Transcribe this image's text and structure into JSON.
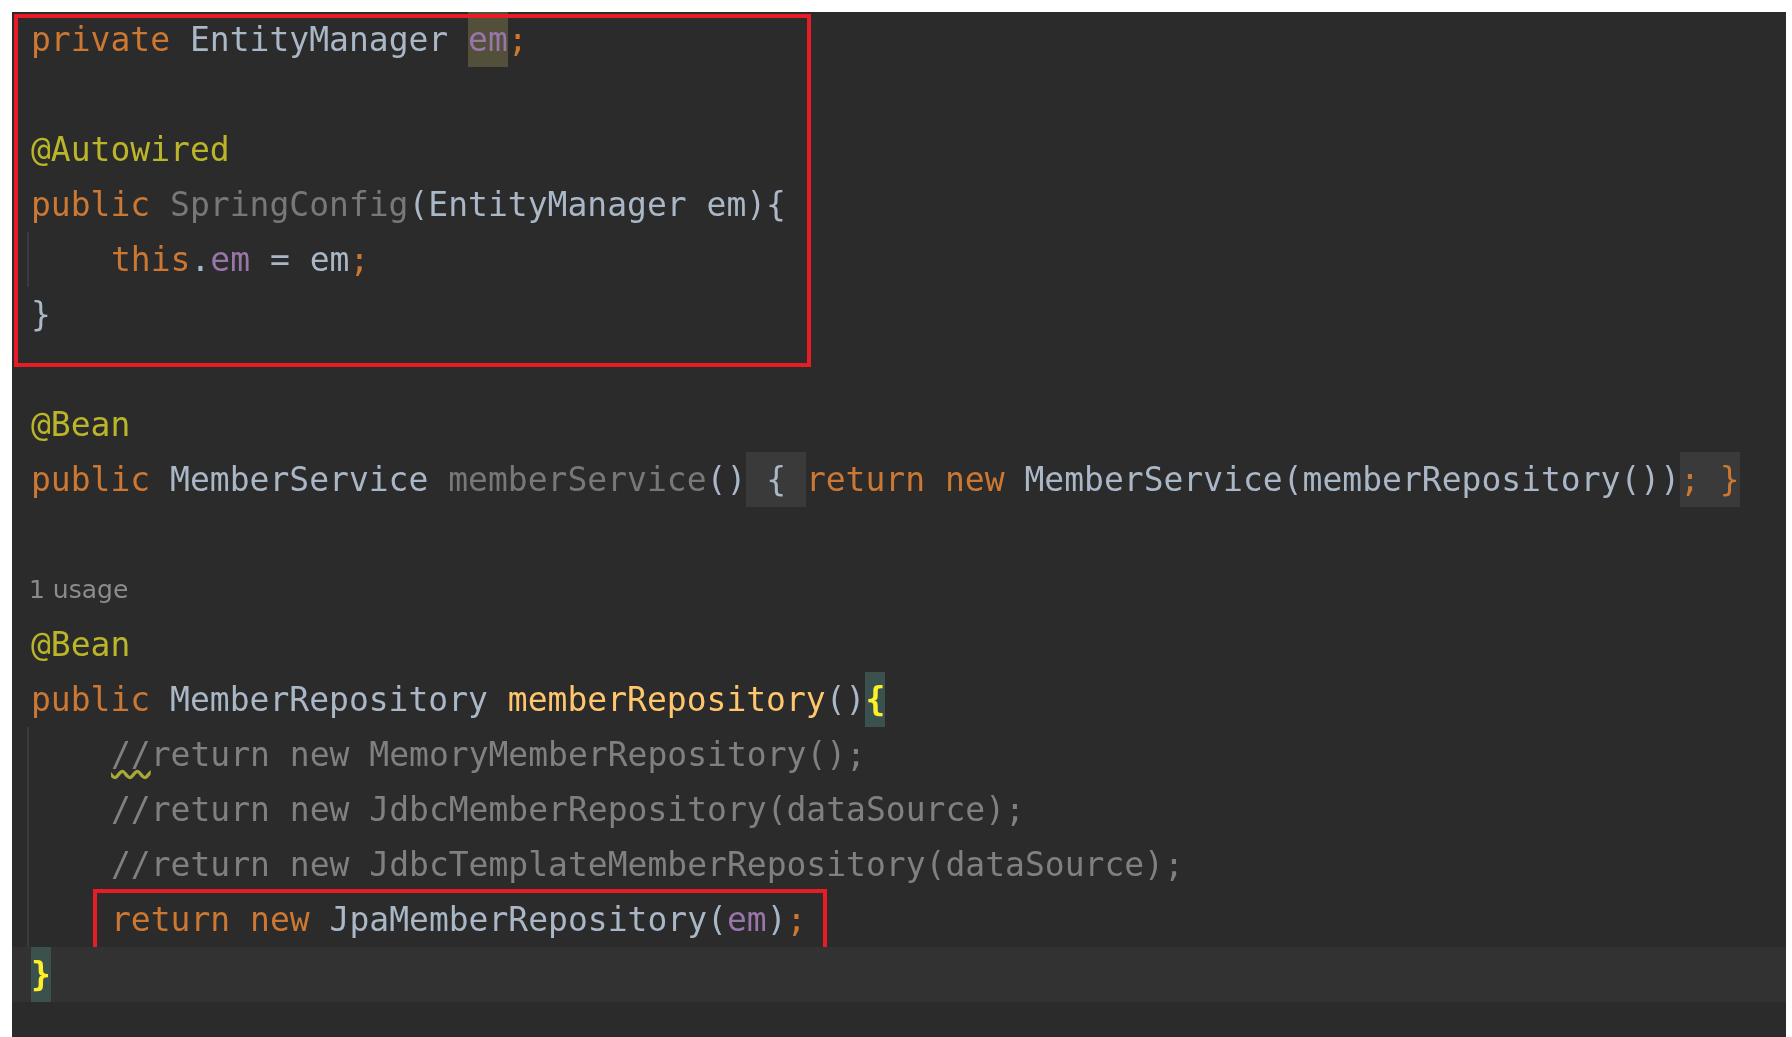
{
  "blocks": [
    {
      "boxed": true,
      "lines": [
        {
          "kind": "code",
          "indented": false,
          "tokens": [
            {
              "text": "private ",
              "kind": "keyword"
            },
            {
              "text": "EntityManager ",
              "kind": "plain"
            },
            {
              "text": "em",
              "kind": "field",
              "highlighted": true
            },
            {
              "text": ";",
              "kind": "keyword"
            }
          ]
        },
        {
          "kind": "blank"
        },
        {
          "kind": "code",
          "indented": false,
          "tokens": [
            {
              "text": "@Autowired",
              "kind": "annotation"
            }
          ]
        },
        {
          "kind": "code",
          "indented": false,
          "tokens": [
            {
              "text": "public ",
              "kind": "keyword"
            },
            {
              "text": "SpringConfig",
              "kind": "unused"
            },
            {
              "text": "(EntityManager em){",
              "kind": "plain"
            }
          ]
        },
        {
          "kind": "code",
          "indented": true,
          "tokens": [
            {
              "text": "this",
              "kind": "keyword"
            },
            {
              "text": ".",
              "kind": "plain"
            },
            {
              "text": "em",
              "kind": "field"
            },
            {
              "text": " = em",
              "kind": "plain"
            },
            {
              "text": ";",
              "kind": "keyword"
            }
          ]
        },
        {
          "kind": "code",
          "indented": false,
          "tokens": [
            {
              "text": "}",
              "kind": "plain"
            }
          ]
        }
      ]
    },
    {
      "boxed": false,
      "lines": [
        {
          "kind": "blank"
        },
        {
          "kind": "code",
          "indented": false,
          "tokens": [
            {
              "text": "@Bean",
              "kind": "annotation"
            }
          ]
        },
        {
          "kind": "code",
          "indented": false,
          "tokens": [
            {
              "text": "public ",
              "kind": "keyword"
            },
            {
              "text": "MemberService ",
              "kind": "plain"
            },
            {
              "text": "memberService",
              "kind": "unused"
            },
            {
              "text": "()",
              "kind": "plain"
            },
            {
              "text": " { ",
              "kind": "plain",
              "highlighted": true
            },
            {
              "text": "return new ",
              "kind": "keyword"
            },
            {
              "text": "MemberService(memberRepository())",
              "kind": "plain"
            },
            {
              "text": "; }",
              "kind": "keyword",
              "highlighted": true
            }
          ]
        },
        {
          "kind": "blank"
        },
        {
          "kind": "hint",
          "text": "1 usage"
        },
        {
          "kind": "code",
          "indented": false,
          "tokens": [
            {
              "text": "@Bean",
              "kind": "annotation"
            }
          ]
        },
        {
          "kind": "code",
          "indented": false,
          "tokens": [
            {
              "text": "public ",
              "kind": "keyword"
            },
            {
              "text": "MemberRepository ",
              "kind": "plain"
            },
            {
              "text": "memberRepository",
              "kind": "method"
            },
            {
              "text": "()",
              "kind": "plain"
            },
            {
              "text": "{",
              "kind": "brace",
              "highlighted": true
            }
          ]
        },
        {
          "kind": "code",
          "indented": true,
          "tokens": [
            {
              "text": "//",
              "kind": "warning"
            },
            {
              "text": "return new MemoryMemberRepository();",
              "kind": "comment"
            }
          ]
        },
        {
          "kind": "code",
          "indented": true,
          "tokens": [
            {
              "text": "//return new JdbcMemberRepository(dataSource);",
              "kind": "comment"
            }
          ]
        },
        {
          "kind": "code",
          "indented": true,
          "tokens": [
            {
              "text": "//return new JdbcTemplateMemberRepository(dataSource);",
              "kind": "comment"
            }
          ]
        }
      ]
    },
    {
      "boxed": true,
      "lines": [
        {
          "kind": "code",
          "indented": true,
          "tokens": [
            {
              "text": "return new ",
              "kind": "keyword"
            },
            {
              "text": "JpaMemberRepository(",
              "kind": "plain"
            },
            {
              "text": "em",
              "kind": "field"
            },
            {
              "text": ")",
              "kind": "plain"
            },
            {
              "text": ";",
              "kind": "keyword"
            }
          ]
        }
      ]
    },
    {
      "boxed": false,
      "lines": [
        {
          "kind": "code",
          "indented": false,
          "current": true,
          "tokens": [
            {
              "text": "}",
              "kind": "brace",
              "highlighted": true
            }
          ]
        }
      ]
    }
  ]
}
